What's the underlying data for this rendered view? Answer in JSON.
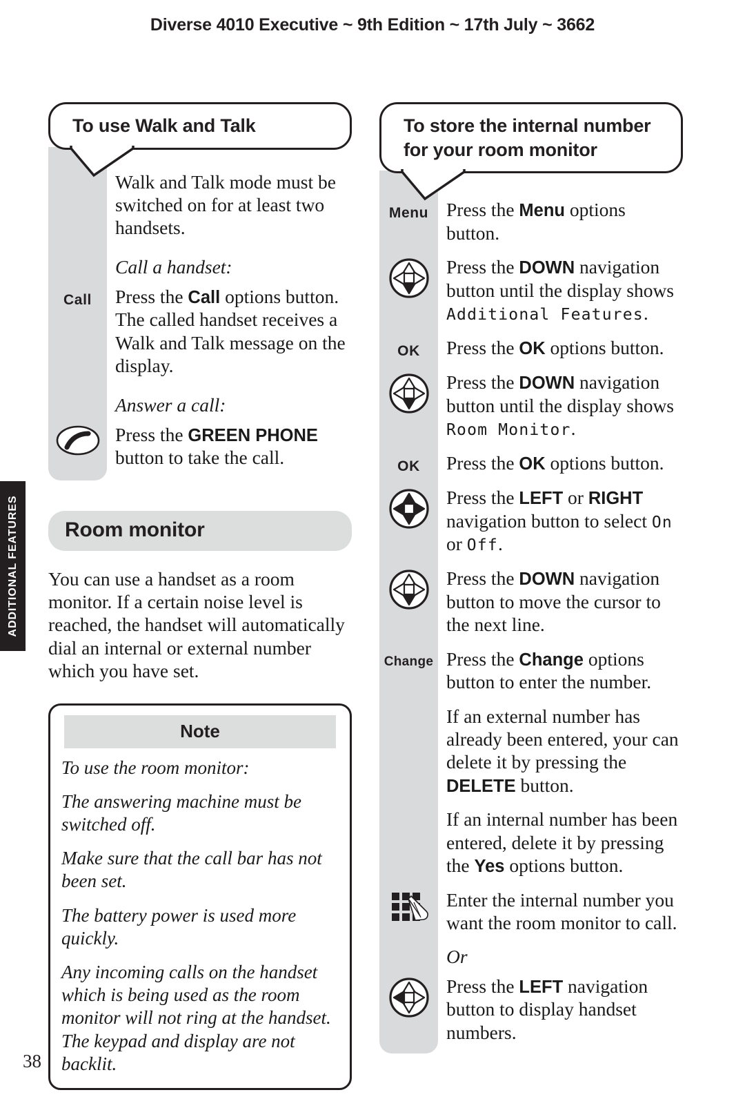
{
  "header": {
    "running_title": "Diverse 4010 Executive ~ 9th Edition ~ 17th July ~ 3662"
  },
  "side_tab": {
    "label": "ADDITIONAL FEATURES"
  },
  "page_number": "38",
  "left_column": {
    "bubble_title": "To use Walk and Talk",
    "steps": [
      {
        "icon": "none",
        "text_html": "Walk and Talk mode must be switched on for at least two handsets."
      },
      {
        "icon": "none",
        "text_html": "<i>Call a handset:</i>"
      },
      {
        "icon": "softkey-call",
        "icon_label": "Call",
        "text_html": "Press the <b>Call</b> options button. The called handset receives a Walk and Talk message on the display."
      },
      {
        "icon": "none",
        "text_html": "<i>Answer a call:</i>"
      },
      {
        "icon": "green-phone",
        "text_html": "Press the <b>GREEN PHONE</b> button to take the call."
      }
    ],
    "section_heading": "Room monitor",
    "section_para": "You can use a handset as a room monitor. If a certain noise level is reached, the handset will automatically dial an internal or external number which you have set.",
    "note": {
      "title": "Note",
      "paragraphs": [
        "To use the room monitor:",
        "The answering machine must be switched off.",
        "Make sure that the call bar has not been set.",
        "The battery power is used more quickly.",
        "Any incoming calls on the handset which is being used as the room monitor will not ring at the handset. The keypad and display are not backlit."
      ]
    }
  },
  "right_column": {
    "bubble_title_line1": "To store the internal number",
    "bubble_title_line2": "for your room monitor",
    "steps": [
      {
        "icon": "softkey-menu",
        "icon_label": "Menu",
        "text_html": "Press the <b>Menu</b> options button."
      },
      {
        "icon": "nav-down",
        "text_html": "Press the <b>DOWN</b> navigation button until the display shows <span class=\"lcd\">Additional Features</span>."
      },
      {
        "icon": "softkey-ok",
        "icon_label": "OK",
        "text_html": "Press the <b>OK</b> options button."
      },
      {
        "icon": "nav-down",
        "text_html": "Press the <b>DOWN</b> navigation button until the display shows <span class=\"lcd\">Room Monitor</span>."
      },
      {
        "icon": "softkey-ok",
        "icon_label": "OK",
        "text_html": "Press the <b>OK</b> options button."
      },
      {
        "icon": "nav-all",
        "text_html": "Press the <b>LEFT</b> or <b>RIGHT</b> navigation button to select <span class=\"lcd\">On</span> or <span class=\"lcd\">Off</span>."
      },
      {
        "icon": "nav-down",
        "text_html": "Press the <b>DOWN</b> navigation button to move the cursor to the next line."
      },
      {
        "icon": "softkey-change",
        "icon_label": "Change",
        "text_html": "Press the <b>Change</b> options button to enter the number."
      },
      {
        "icon": "none",
        "text_html": "If an external number has already been entered, your can delete it by pressing the <b>DELETE</b> button."
      },
      {
        "icon": "none",
        "text_html": "If an internal number has been entered, delete it by pressing the <b>Yes</b> options button."
      },
      {
        "icon": "keypad",
        "text_html": "Enter the internal number you want the room monitor to call."
      },
      {
        "icon": "none",
        "text_html": "<i>Or</i>"
      },
      {
        "icon": "nav-left",
        "text_html": "Press the <b>LEFT</b> navigation button to display handset numbers."
      }
    ]
  },
  "colors": {
    "rail_grey": "#d9dadb",
    "pill_grey": "#dcdddd",
    "ink": "#231f20",
    "tab_black": "#231f20"
  }
}
